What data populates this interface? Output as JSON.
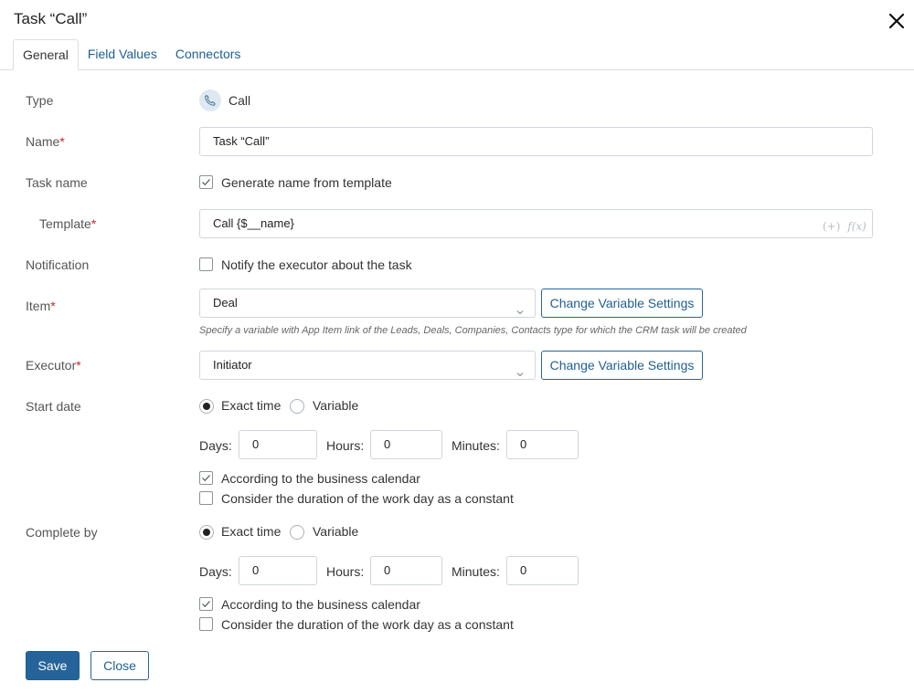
{
  "dialog": {
    "title": "Task “Call”"
  },
  "tabs": [
    {
      "label": "General"
    },
    {
      "label": "Field Values"
    },
    {
      "label": "Connectors"
    }
  ],
  "form": {
    "type": {
      "label": "Type",
      "value": "Call",
      "icon": "phone-icon"
    },
    "name": {
      "label": "Name",
      "required": "*",
      "value": "Task “Call”"
    },
    "task_name": {
      "label": "Task name",
      "checkbox_label": "Generate name from template",
      "checked": true
    },
    "template": {
      "label": "Template",
      "required": "*",
      "value": "Call {$__name}",
      "icon_plus": "(+)",
      "icon_fx": "f(x)"
    },
    "notification": {
      "label": "Notification",
      "checkbox_label": "Notify the executor about the task",
      "checked": false
    },
    "item": {
      "label": "Item",
      "required": "*",
      "value": "Deal",
      "button": "Change Variable Settings",
      "hint": "Specify a variable with App Item link of the Leads, Deals, Companies, Contacts type for which the CRM task will be created"
    },
    "executor": {
      "label": "Executor",
      "required": "*",
      "value": "Initiator",
      "button": "Change Variable Settings"
    },
    "start_date": {
      "label": "Start date",
      "radio_exact": "Exact time",
      "radio_variable": "Variable",
      "selected": "Exact time",
      "days_label": "Days:",
      "days": "0",
      "hours_label": "Hours:",
      "hours": "0",
      "minutes_label": "Minutes:",
      "minutes": "0",
      "business_calendar": "According to the business calendar",
      "business_calendar_checked": true,
      "constant_day": "Consider the duration of the work day as a constant",
      "constant_day_checked": false
    },
    "complete_by": {
      "label": "Complete by",
      "radio_exact": "Exact time",
      "radio_variable": "Variable",
      "selected": "Exact time",
      "days_label": "Days:",
      "days": "0",
      "hours_label": "Hours:",
      "hours": "0",
      "minutes_label": "Minutes:",
      "minutes": "0",
      "business_calendar": "According to the business calendar",
      "business_calendar_checked": true,
      "constant_day": "Consider the duration of the work day as a constant",
      "constant_day_checked": false
    }
  },
  "footer": {
    "save": "Save",
    "close": "Close"
  }
}
